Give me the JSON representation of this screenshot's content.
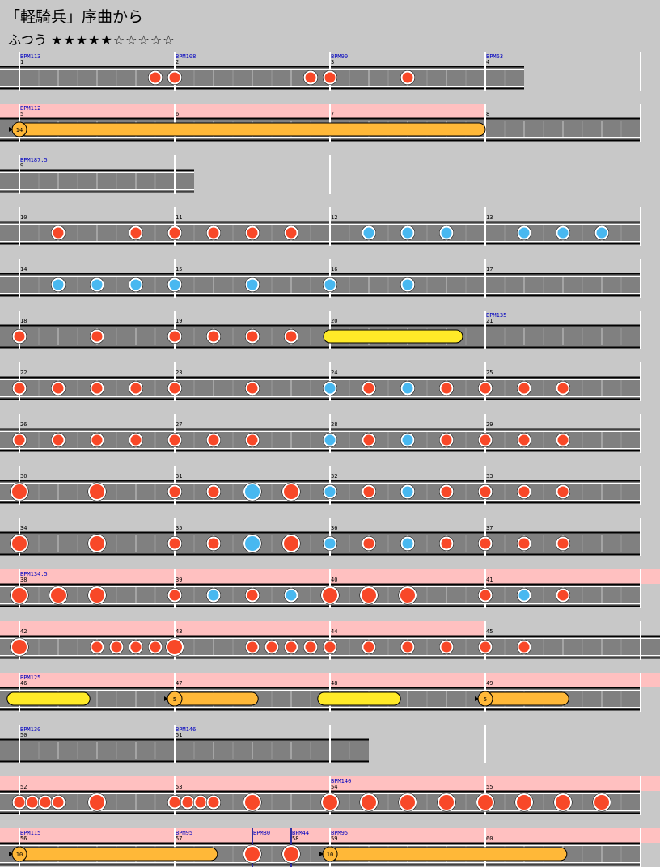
{
  "title": "「軽騎兵」序曲から",
  "difficulty": {
    "label": "ふつう",
    "stars_filled": "★★★★★",
    "stars_empty": "☆☆☆☆☆",
    "level": 5,
    "max": 10
  },
  "colors": {
    "don": "#f84828",
    "ka": "#48b8f0",
    "drumroll": "#ffea28",
    "balloon": "#ffb838",
    "gogo": "#ffc0c0",
    "lane": "#808080",
    "bpm": "#0000c0"
  },
  "chart_data": {
    "type": "table",
    "description": "taiko note chart",
    "rows": [
      {
        "measures": [
          {
            "n": "1",
            "bpm": "BPM113"
          },
          {
            "n": "2",
            "bpm": "BPM108"
          },
          {
            "n": "3",
            "bpm": "BPM90"
          },
          {
            "n": "4",
            "bpm": "BPM63"
          }
        ],
        "bars": 3.25,
        "notes": [
          [
            7,
            "d"
          ],
          [
            8,
            "d"
          ],
          [
            15,
            "d"
          ],
          [
            16,
            "d"
          ],
          [
            20,
            "d"
          ]
        ]
      },
      {
        "measures": [
          {
            "n": "5",
            "bpm": "BPM112"
          },
          {
            "n": "6"
          },
          {
            "n": "7"
          },
          {
            "n": "8"
          }
        ],
        "bars": 4,
        "gogo": [
          0,
          3
        ],
        "balloons": [
          [
            0,
            24,
            "14"
          ]
        ]
      },
      {
        "measures": [
          {
            "n": "9",
            "bpm": "BPM187.5"
          }
        ],
        "bars": 1.125
      },
      {
        "measures": [
          {
            "n": "10"
          },
          {
            "n": "11"
          },
          {
            "n": "12"
          },
          {
            "n": "13"
          }
        ],
        "bars": 4,
        "notes": [
          [
            2,
            "d"
          ],
          [
            6,
            "d"
          ],
          [
            8,
            "d"
          ],
          [
            10,
            "d"
          ],
          [
            12,
            "d"
          ],
          [
            14,
            "d"
          ],
          [
            18,
            "k"
          ],
          [
            20,
            "k"
          ],
          [
            22,
            "k"
          ],
          [
            26,
            "k"
          ],
          [
            28,
            "k"
          ],
          [
            30,
            "k"
          ]
        ]
      },
      {
        "measures": [
          {
            "n": "14"
          },
          {
            "n": "15"
          },
          {
            "n": "16"
          },
          {
            "n": "17"
          }
        ],
        "bars": 4,
        "notes": [
          [
            2,
            "k"
          ],
          [
            4,
            "k"
          ],
          [
            6,
            "k"
          ],
          [
            8,
            "k"
          ],
          [
            12,
            "k"
          ],
          [
            16,
            "k"
          ],
          [
            20,
            "k"
          ]
        ]
      },
      {
        "measures": [
          {
            "n": "18"
          },
          {
            "n": "19"
          },
          {
            "n": "20"
          },
          {
            "n": "21",
            "bpm": "BPM135"
          }
        ],
        "bars": 4,
        "notes": [
          [
            0,
            "d"
          ],
          [
            4,
            "d"
          ],
          [
            8,
            "d"
          ],
          [
            10,
            "d"
          ],
          [
            12,
            "d"
          ],
          [
            14,
            "d"
          ]
        ],
        "rolls": [
          [
            16,
            22.5
          ]
        ]
      },
      {
        "measures": [
          {
            "n": "22"
          },
          {
            "n": "23"
          },
          {
            "n": "24"
          },
          {
            "n": "25"
          }
        ],
        "bars": 4,
        "notes": [
          [
            0,
            "d"
          ],
          [
            2,
            "d"
          ],
          [
            4,
            "d"
          ],
          [
            6,
            "d"
          ],
          [
            8,
            "d"
          ],
          [
            12,
            "d"
          ],
          [
            16,
            "k"
          ],
          [
            18,
            "d"
          ],
          [
            20,
            "k"
          ],
          [
            22,
            "d"
          ],
          [
            24,
            "d"
          ],
          [
            26,
            "d"
          ],
          [
            28,
            "d"
          ]
        ]
      },
      {
        "measures": [
          {
            "n": "26"
          },
          {
            "n": "27"
          },
          {
            "n": "28"
          },
          {
            "n": "29"
          }
        ],
        "bars": 4,
        "notes": [
          [
            0,
            "d"
          ],
          [
            2,
            "d"
          ],
          [
            4,
            "d"
          ],
          [
            6,
            "d"
          ],
          [
            8,
            "d"
          ],
          [
            10,
            "d"
          ],
          [
            12,
            "d"
          ],
          [
            16,
            "k"
          ],
          [
            18,
            "d"
          ],
          [
            20,
            "k"
          ],
          [
            22,
            "d"
          ],
          [
            24,
            "d"
          ],
          [
            26,
            "d"
          ],
          [
            28,
            "d"
          ]
        ]
      },
      {
        "measures": [
          {
            "n": "30"
          },
          {
            "n": "31"
          },
          {
            "n": "32"
          },
          {
            "n": "33"
          }
        ],
        "bars": 4,
        "notes": [
          [
            0,
            "D"
          ],
          [
            4,
            "D"
          ],
          [
            8,
            "d"
          ],
          [
            10,
            "d"
          ],
          [
            12,
            "K"
          ],
          [
            14,
            "D"
          ],
          [
            16,
            "k"
          ],
          [
            18,
            "d"
          ],
          [
            20,
            "k"
          ],
          [
            22,
            "d"
          ],
          [
            24,
            "d"
          ],
          [
            26,
            "d"
          ],
          [
            28,
            "d"
          ]
        ]
      },
      {
        "measures": [
          {
            "n": "34"
          },
          {
            "n": "35"
          },
          {
            "n": "36"
          },
          {
            "n": "37"
          }
        ],
        "bars": 4,
        "notes": [
          [
            0,
            "D"
          ],
          [
            4,
            "D"
          ],
          [
            8,
            "d"
          ],
          [
            10,
            "d"
          ],
          [
            12,
            "K"
          ],
          [
            14,
            "D"
          ],
          [
            16,
            "k"
          ],
          [
            18,
            "d"
          ],
          [
            20,
            "k"
          ],
          [
            22,
            "d"
          ],
          [
            24,
            "d"
          ],
          [
            26,
            "d"
          ],
          [
            28,
            "d"
          ]
        ]
      },
      {
        "measures": [
          {
            "n": "38",
            "bpm": "BPM134.5"
          },
          {
            "n": "39"
          },
          {
            "n": "40"
          },
          {
            "n": "41"
          }
        ],
        "bars": 4,
        "gogo": [
          0,
          4
        ],
        "notes": [
          [
            0,
            "D"
          ],
          [
            2,
            "D"
          ],
          [
            4,
            "D"
          ],
          [
            8,
            "d"
          ],
          [
            10,
            "k"
          ],
          [
            12,
            "d"
          ],
          [
            14,
            "k"
          ],
          [
            16,
            "D"
          ],
          [
            18,
            "D"
          ],
          [
            20,
            "D"
          ],
          [
            24,
            "d"
          ],
          [
            26,
            "k"
          ],
          [
            28,
            "d"
          ]
        ]
      },
      {
        "measures": [
          {
            "n": "42"
          },
          {
            "n": "43"
          },
          {
            "n": "44"
          },
          {
            "n": "45"
          }
        ],
        "bars": 4.5,
        "gogo": [
          0,
          3
        ],
        "notes": [
          [
            0,
            "D"
          ],
          [
            4,
            "d"
          ],
          [
            5,
            "d"
          ],
          [
            6,
            "d"
          ],
          [
            7,
            "d"
          ],
          [
            8,
            "D"
          ],
          [
            12,
            "d"
          ],
          [
            13,
            "d"
          ],
          [
            14,
            "d"
          ],
          [
            15,
            "d"
          ],
          [
            16,
            "d"
          ],
          [
            18,
            "d"
          ],
          [
            20,
            "d"
          ],
          [
            22,
            "d"
          ],
          [
            24,
            "d"
          ],
          [
            26,
            "d"
          ]
        ]
      },
      {
        "measures": [
          {
            "n": "46",
            "bpm": "BPM125"
          },
          {
            "n": "47"
          },
          {
            "n": "48"
          },
          {
            "n": "49"
          }
        ],
        "bars": 4,
        "gogo": [
          0,
          4
        ],
        "rolls": [
          [
            -0.3,
            3.3
          ],
          [
            15.7,
            19.3
          ]
        ],
        "balloons": [
          [
            8,
            12.3,
            "5"
          ],
          [
            24,
            28.3,
            "5"
          ]
        ]
      },
      {
        "measures": [
          {
            "n": "50",
            "bpm": "BPM130"
          },
          {
            "n": "51",
            "bpm": "BPM146"
          }
        ],
        "bars": 2.25
      },
      {
        "measures": [
          {
            "n": "52"
          },
          {
            "n": "53"
          },
          {
            "n": "54",
            "bpm": "BPM140"
          },
          {
            "n": "55"
          }
        ],
        "bars": 4,
        "gogo": [
          0,
          4
        ],
        "notes": [
          [
            0,
            "d"
          ],
          [
            0.667,
            "d"
          ],
          [
            1.333,
            "d"
          ],
          [
            2,
            "d"
          ],
          [
            4,
            "D"
          ],
          [
            8,
            "d"
          ],
          [
            8.667,
            "d"
          ],
          [
            9.333,
            "d"
          ],
          [
            10,
            "d"
          ],
          [
            12,
            "D"
          ],
          [
            16,
            "D"
          ],
          [
            18,
            "D"
          ],
          [
            20,
            "D"
          ],
          [
            22,
            "D"
          ],
          [
            24,
            "D"
          ],
          [
            26,
            "D"
          ],
          [
            28,
            "D"
          ],
          [
            30,
            "D"
          ]
        ]
      },
      {
        "measures": [
          {
            "n": "56",
            "bpm": "BPM115"
          },
          {
            "n": "57",
            "bpm": "BPM95"
          },
          {
            "n": "",
            "bpm": "BPM80"
          },
          {
            "n": "58",
            "bpm": "BPM44"
          },
          {
            "n": "59",
            "bpm": "BPM95"
          },
          {
            "n": "60"
          }
        ],
        "bars": 4,
        "gogo": [
          0,
          4
        ],
        "notes": [
          [
            12,
            "D"
          ],
          [
            14,
            "D"
          ]
        ],
        "balloons": [
          [
            0,
            10.2,
            "10"
          ],
          [
            16,
            28.2,
            "10"
          ]
        ]
      }
    ]
  }
}
